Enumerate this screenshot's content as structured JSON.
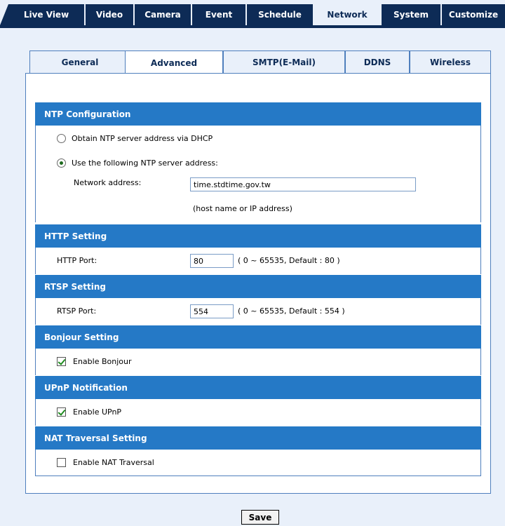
{
  "topnav": {
    "tabs": [
      {
        "label": "Live View"
      },
      {
        "label": "Video"
      },
      {
        "label": "Camera"
      },
      {
        "label": "Event"
      },
      {
        "label": "Schedule"
      },
      {
        "label": "Network",
        "active": true
      },
      {
        "label": "System"
      },
      {
        "label": "Customize"
      }
    ]
  },
  "subtabs": [
    {
      "label": "General"
    },
    {
      "label": "Advanced",
      "active": true
    },
    {
      "label": "SMTP(E-Mail)"
    },
    {
      "label": "DDNS"
    },
    {
      "label": "Wireless"
    }
  ],
  "ntp": {
    "title": "NTP Configuration",
    "option_dhcp": "Obtain NTP server address via DHCP",
    "option_manual": "Use the following NTP server address:",
    "selected": "manual",
    "address_label": "Network address:",
    "address_value": "time.stdtime.gov.tw",
    "address_hint": "(host name or IP address)"
  },
  "http": {
    "title": "HTTP Setting",
    "port_label": "HTTP Port:",
    "port_value": "80",
    "port_hint": "( 0 ~ 65535, Default : 80 )"
  },
  "rtsp": {
    "title": "RTSP Setting",
    "port_label": "RTSP Port:",
    "port_value": "554",
    "port_hint": "( 0 ~ 65535, Default : 554 )"
  },
  "bonjour": {
    "title": "Bonjour Setting",
    "enable_label": "Enable Bonjour",
    "enabled": true
  },
  "upnp": {
    "title": "UPnP Notification",
    "enable_label": "Enable UPnP",
    "enabled": true
  },
  "nat": {
    "title": "NAT Traversal Setting",
    "enable_label": "Enable NAT Traversal",
    "enabled": false
  },
  "save_label": "Save",
  "colors": {
    "nav": "#0d2b56",
    "section_header": "#2579c6",
    "background": "#e9f0fa"
  }
}
